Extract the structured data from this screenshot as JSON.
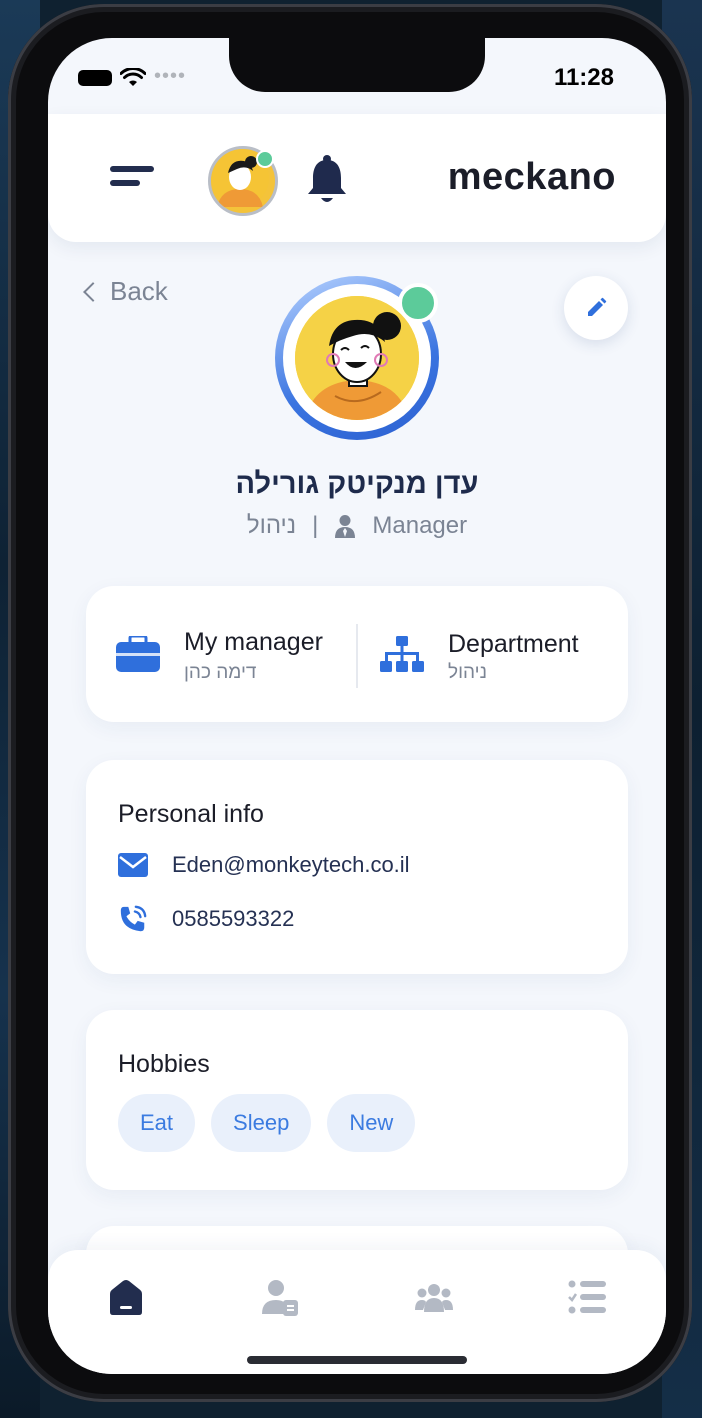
{
  "status_bar": {
    "time": "11:28"
  },
  "app": {
    "logo": "meckano"
  },
  "header": {
    "menu_icon": "hamburger-menu-icon",
    "notifications_icon": "bell-icon"
  },
  "profile": {
    "back_label": "Back",
    "name": "עדן מנקיטק גורילה",
    "department": "ניהול",
    "role": "Manager",
    "online": true
  },
  "org_card": {
    "manager_title": "My manager",
    "manager_name": "דימה כהן",
    "department_title": "Department",
    "department_name": "ניהול"
  },
  "personal_info": {
    "title": "Personal info",
    "email": "Eden@monkeytech.co.il",
    "phone": "0585593322"
  },
  "hobbies": {
    "title": "Hobbies",
    "items": [
      "Eat",
      "Sleep",
      "New"
    ]
  },
  "tabbar": {
    "tabs": [
      "home-icon",
      "employee-card-icon",
      "team-icon",
      "task-list-icon"
    ],
    "active_index": 0
  },
  "colors": {
    "accent": "#3b7be0",
    "dark_navy": "#222d4e",
    "online": "#5ccb9a",
    "background": "#f4f7fc"
  }
}
